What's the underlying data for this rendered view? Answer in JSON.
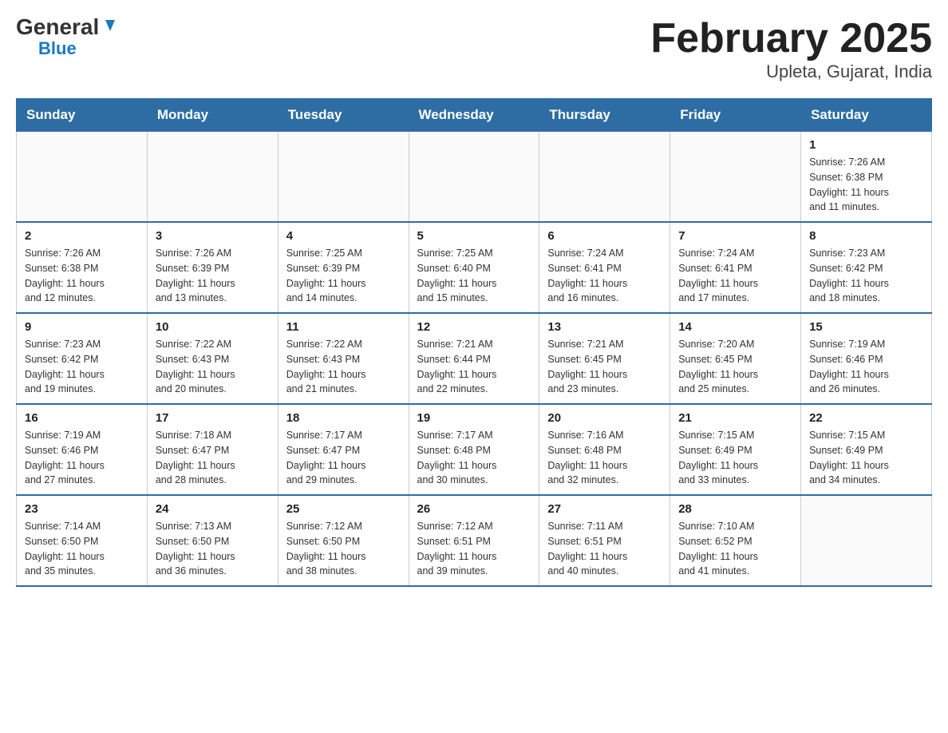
{
  "header": {
    "logo": {
      "general": "General",
      "blue": "Blue"
    },
    "title": "February 2025",
    "location": "Upleta, Gujarat, India"
  },
  "weekdays": [
    "Sunday",
    "Monday",
    "Tuesday",
    "Wednesday",
    "Thursday",
    "Friday",
    "Saturday"
  ],
  "weeks": [
    [
      {
        "day": "",
        "info": ""
      },
      {
        "day": "",
        "info": ""
      },
      {
        "day": "",
        "info": ""
      },
      {
        "day": "",
        "info": ""
      },
      {
        "day": "",
        "info": ""
      },
      {
        "day": "",
        "info": ""
      },
      {
        "day": "1",
        "info": "Sunrise: 7:26 AM\nSunset: 6:38 PM\nDaylight: 11 hours\nand 11 minutes."
      }
    ],
    [
      {
        "day": "2",
        "info": "Sunrise: 7:26 AM\nSunset: 6:38 PM\nDaylight: 11 hours\nand 12 minutes."
      },
      {
        "day": "3",
        "info": "Sunrise: 7:26 AM\nSunset: 6:39 PM\nDaylight: 11 hours\nand 13 minutes."
      },
      {
        "day": "4",
        "info": "Sunrise: 7:25 AM\nSunset: 6:39 PM\nDaylight: 11 hours\nand 14 minutes."
      },
      {
        "day": "5",
        "info": "Sunrise: 7:25 AM\nSunset: 6:40 PM\nDaylight: 11 hours\nand 15 minutes."
      },
      {
        "day": "6",
        "info": "Sunrise: 7:24 AM\nSunset: 6:41 PM\nDaylight: 11 hours\nand 16 minutes."
      },
      {
        "day": "7",
        "info": "Sunrise: 7:24 AM\nSunset: 6:41 PM\nDaylight: 11 hours\nand 17 minutes."
      },
      {
        "day": "8",
        "info": "Sunrise: 7:23 AM\nSunset: 6:42 PM\nDaylight: 11 hours\nand 18 minutes."
      }
    ],
    [
      {
        "day": "9",
        "info": "Sunrise: 7:23 AM\nSunset: 6:42 PM\nDaylight: 11 hours\nand 19 minutes."
      },
      {
        "day": "10",
        "info": "Sunrise: 7:22 AM\nSunset: 6:43 PM\nDaylight: 11 hours\nand 20 minutes."
      },
      {
        "day": "11",
        "info": "Sunrise: 7:22 AM\nSunset: 6:43 PM\nDaylight: 11 hours\nand 21 minutes."
      },
      {
        "day": "12",
        "info": "Sunrise: 7:21 AM\nSunset: 6:44 PM\nDaylight: 11 hours\nand 22 minutes."
      },
      {
        "day": "13",
        "info": "Sunrise: 7:21 AM\nSunset: 6:45 PM\nDaylight: 11 hours\nand 23 minutes."
      },
      {
        "day": "14",
        "info": "Sunrise: 7:20 AM\nSunset: 6:45 PM\nDaylight: 11 hours\nand 25 minutes."
      },
      {
        "day": "15",
        "info": "Sunrise: 7:19 AM\nSunset: 6:46 PM\nDaylight: 11 hours\nand 26 minutes."
      }
    ],
    [
      {
        "day": "16",
        "info": "Sunrise: 7:19 AM\nSunset: 6:46 PM\nDaylight: 11 hours\nand 27 minutes."
      },
      {
        "day": "17",
        "info": "Sunrise: 7:18 AM\nSunset: 6:47 PM\nDaylight: 11 hours\nand 28 minutes."
      },
      {
        "day": "18",
        "info": "Sunrise: 7:17 AM\nSunset: 6:47 PM\nDaylight: 11 hours\nand 29 minutes."
      },
      {
        "day": "19",
        "info": "Sunrise: 7:17 AM\nSunset: 6:48 PM\nDaylight: 11 hours\nand 30 minutes."
      },
      {
        "day": "20",
        "info": "Sunrise: 7:16 AM\nSunset: 6:48 PM\nDaylight: 11 hours\nand 32 minutes."
      },
      {
        "day": "21",
        "info": "Sunrise: 7:15 AM\nSunset: 6:49 PM\nDaylight: 11 hours\nand 33 minutes."
      },
      {
        "day": "22",
        "info": "Sunrise: 7:15 AM\nSunset: 6:49 PM\nDaylight: 11 hours\nand 34 minutes."
      }
    ],
    [
      {
        "day": "23",
        "info": "Sunrise: 7:14 AM\nSunset: 6:50 PM\nDaylight: 11 hours\nand 35 minutes."
      },
      {
        "day": "24",
        "info": "Sunrise: 7:13 AM\nSunset: 6:50 PM\nDaylight: 11 hours\nand 36 minutes."
      },
      {
        "day": "25",
        "info": "Sunrise: 7:12 AM\nSunset: 6:50 PM\nDaylight: 11 hours\nand 38 minutes."
      },
      {
        "day": "26",
        "info": "Sunrise: 7:12 AM\nSunset: 6:51 PM\nDaylight: 11 hours\nand 39 minutes."
      },
      {
        "day": "27",
        "info": "Sunrise: 7:11 AM\nSunset: 6:51 PM\nDaylight: 11 hours\nand 40 minutes."
      },
      {
        "day": "28",
        "info": "Sunrise: 7:10 AM\nSunset: 6:52 PM\nDaylight: 11 hours\nand 41 minutes."
      },
      {
        "day": "",
        "info": ""
      }
    ]
  ]
}
